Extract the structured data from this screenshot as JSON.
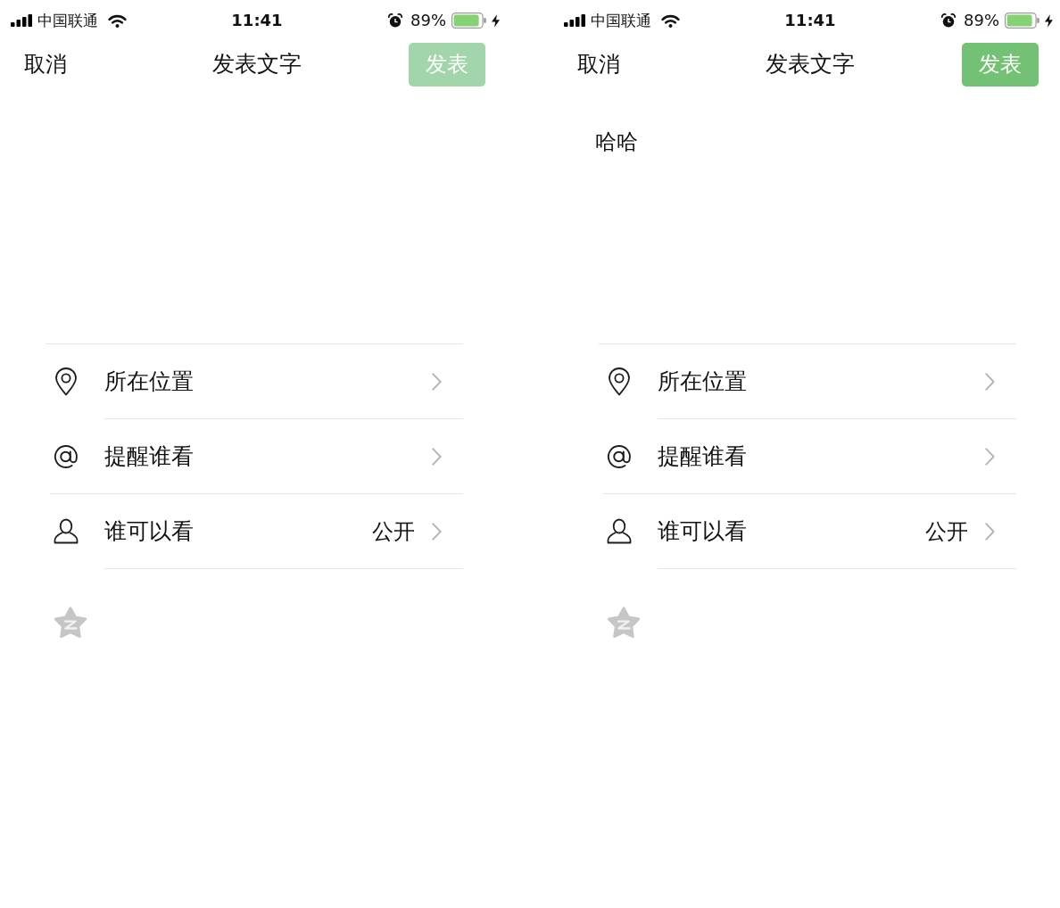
{
  "screens": [
    {
      "status_bar": {
        "carrier": "中国联通",
        "time": "11:41",
        "battery": "89%"
      },
      "nav": {
        "cancel": "取消",
        "title": "发表文字",
        "publish": {
          "label": "发表",
          "disabled": true
        }
      },
      "options": [
        {
          "kind": "location",
          "label": "所在位置"
        },
        {
          "kind": "mention",
          "label": "提醒谁看"
        },
        {
          "kind": "visibility",
          "label": "谁可以看",
          "value": "公开"
        }
      ]
    },
    {
      "status_bar": {
        "carrier": "中国联通",
        "time": "11:41",
        "battery": "89%"
      },
      "nav": {
        "cancel": "取消",
        "title": "发表文字",
        "publish": {
          "label": "发表",
          "disabled": false
        }
      },
      "post_text": "哈哈",
      "options": [
        {
          "kind": "location",
          "label": "所在位置"
        },
        {
          "kind": "mention",
          "label": "提醒谁看"
        },
        {
          "kind": "visibility",
          "label": "谁可以看",
          "value": "公开"
        }
      ]
    }
  ]
}
